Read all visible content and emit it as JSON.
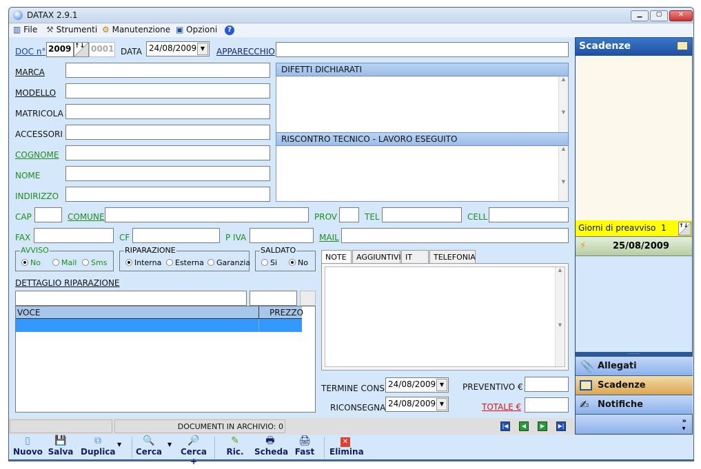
{
  "window": {
    "title": "DATAX 2.9.1"
  },
  "menu": [
    {
      "label": "File",
      "icon": "file-menu-icon"
    },
    {
      "label": "Strumenti",
      "icon": "tools-icon"
    },
    {
      "label": "Manutenzione",
      "icon": "maintenance-icon"
    },
    {
      "label": "Opzioni",
      "icon": "options-icon"
    }
  ],
  "form": {
    "doc_label": "DOC n°",
    "doc_year": "2009",
    "doc_number": "0001",
    "data_label": "DATA",
    "data_value": "24/08/2009",
    "apparecchio_label": "APPARECCHIO",
    "fields": [
      "MARCA",
      "MODELLO",
      "MATRICOLA",
      "ACCESSORI",
      "COGNOME",
      "NOME",
      "INDIRIZZO"
    ],
    "difetti": "DIFETTI DICHIARATI",
    "riscontro": "RISCONTRO TECNICO - LAVORO ESEGUITO",
    "cap": "CAP",
    "comune": "COMUNE",
    "prov": "PROV",
    "tel": "TEL",
    "cell": "CELL",
    "fax": "FAX",
    "cf": "CF",
    "piva": "P IVA",
    "mail": "MAIL",
    "avviso": {
      "title": "AVVISO",
      "options": [
        "No",
        "Mail",
        "Sms"
      ],
      "selected": "No"
    },
    "riparazione": {
      "title": "RIPARAZIONE",
      "options": [
        "Interna",
        "Esterna",
        "Garanzia"
      ],
      "selected": "Interna"
    },
    "saldato": {
      "title": "SALDATO",
      "options": [
        "Si",
        "No"
      ],
      "selected": "No"
    },
    "dettaglio": "DETTAGLIO RIPARAZIONE",
    "table": {
      "columns": [
        "VOCE",
        "PREZZO"
      ]
    },
    "tabs": [
      "NOTE",
      "AGGIUNTIVI",
      "IT",
      "TELEFONIA"
    ],
    "active_tab": "NOTE",
    "termine_label": "TERMINE CONS",
    "termine_value": "24/08/2009",
    "riconsegna_label": "RICONSEGNA",
    "riconsegna_value": "24/08/2009",
    "preventivo": "PREVENTIVO €",
    "totale": "TOTALE €"
  },
  "status": {
    "documents": "DOCUMENTI IN ARCHIVIO: 0"
  },
  "toolbar": [
    "Nuovo",
    "Salva",
    "Duplica",
    "Cerca",
    "Cerca +",
    "Ric.",
    "Scheda",
    "Fast",
    "Elimina"
  ],
  "panel": {
    "title": "Scadenze",
    "preavviso_label": "Giorni di preavviso",
    "preavviso_value": "1",
    "date": "25/08/2009",
    "buttons": [
      "Allegati",
      "Scadenze",
      "Notifiche"
    ],
    "active": "Scadenze"
  },
  "colors": {
    "background": "#d5e8fb",
    "green_label": "#1e8a1e",
    "totale_red": "#e01010",
    "panel_header": "#2a5fb0",
    "preavviso_yellow": "#ffff00"
  }
}
